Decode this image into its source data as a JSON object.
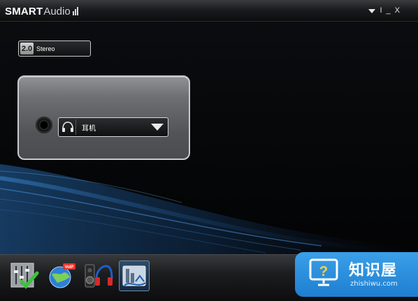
{
  "app": {
    "brand_smart": "SMART",
    "brand_audio": "Audio"
  },
  "window_controls": {
    "minimize": "_",
    "close": "X",
    "divider": "I"
  },
  "mode": {
    "badge": "2.0",
    "label": "Stereo"
  },
  "device": {
    "selected": "耳机"
  },
  "toolbar": {
    "items": [
      {
        "icon": "equalizer-check-icon"
      },
      {
        "icon": "voip-globe-icon"
      },
      {
        "icon": "speaker-headphone-icon"
      },
      {
        "icon": "audio-director-icon"
      }
    ]
  },
  "watermark": {
    "title": "知识屋",
    "url": "zhishiwu.com"
  },
  "colors": {
    "accent_blue": "#1e7ed1",
    "panel_border": "#c9cbce"
  }
}
